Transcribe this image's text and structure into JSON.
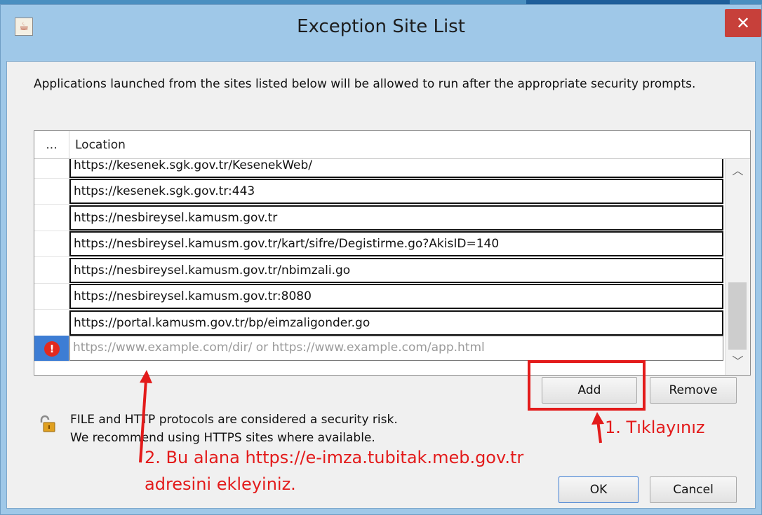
{
  "window": {
    "title": "Exception Site List",
    "close_glyph": "✕",
    "app_icon": "java-cup-icon"
  },
  "description": "Applications launched from the sites listed below will be allowed to run after the appropriate security prompts.",
  "table": {
    "header_dots": "...",
    "header_location": "Location",
    "rows": [
      "https://kesenek.sgk.gov.tr/KesenekWeb/",
      "https://kesenek.sgk.gov.tr:443",
      "https://nesbireysel.kamusm.gov.tr",
      "https://nesbireysel.kamusm.gov.tr/kart/sifre/Degistirme.go?AkisID=140",
      "https://nesbireysel.kamusm.gov.tr/nbimzali.go",
      "https://nesbireysel.kamusm.gov.tr:8080",
      "https://portal.kamusm.gov.tr/bp/eimzaligonder.go"
    ],
    "edit_placeholder": "https://www.example.com/dir/ or https://www.example.com/app.html",
    "edit_icon_glyph": "!"
  },
  "buttons": {
    "add": "Add",
    "remove": "Remove",
    "ok": "OK",
    "cancel": "Cancel"
  },
  "warning": {
    "line1": "FILE and HTTP protocols are considered a security risk.",
    "line2": "We recommend using HTTPS sites where available."
  },
  "annotations": {
    "step1": "1. Tıklayınız",
    "step2_line1": "2. Bu alana https://e-imza.tubitak.meb.gov.tr",
    "step2_line2": "adresini ekleyiniz.",
    "color": "#e31b1b"
  },
  "colors": {
    "titlebar": "#9fc8e8",
    "close": "#c7403a",
    "selection": "#3d7dd4"
  }
}
